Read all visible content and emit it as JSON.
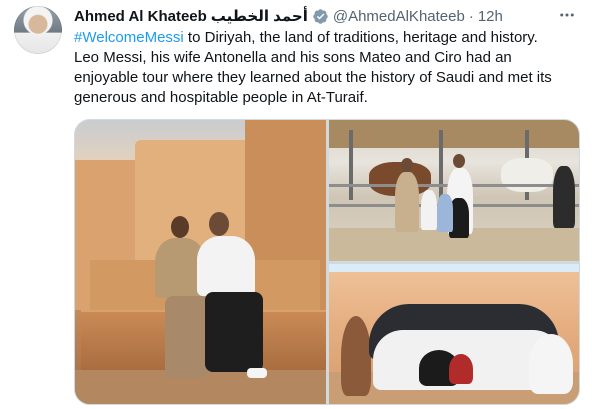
{
  "tweet": {
    "author_name": "Ahmed Al Khateeb",
    "author_name_ar": "أحمد الخطيب",
    "handle": "@AhmedAlKhateeb",
    "separator": "·",
    "time": "12h",
    "more_icon": "ellipsis-icon",
    "verified_icon": "verified-badge-icon",
    "colors": {
      "link": "#1d9bf0",
      "verified": "#829aab",
      "text": "#0f1419",
      "muted": "#536471"
    },
    "text": {
      "hashtag": "#WelcomeMessi",
      "line1_rest": " to Diriyah, the land of traditions, heritage and history.",
      "line2": "Leo Messi, his wife Antonella and his sons Mateo and Ciro had an",
      "line3": "enjoyable tour where they learned about the history of Saudi and met its",
      "line4": "generous and hospitable people in At-Turaif."
    },
    "media": [
      {
        "name": "photo-couple-at-turaif"
      },
      {
        "name": "photo-family-with-horses"
      },
      {
        "name": "photo-group-with-locals"
      }
    ]
  }
}
